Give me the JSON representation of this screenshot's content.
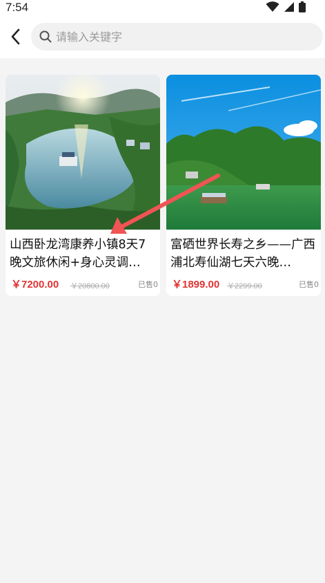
{
  "status_bar": {
    "time": "7:54",
    "icons": [
      "wifi-icon",
      "signal-icon",
      "battery-icon"
    ]
  },
  "header": {
    "back_icon": "chevron-left-icon",
    "search": {
      "placeholder": "请输入关键字",
      "value": ""
    }
  },
  "products": [
    {
      "title": "山西卧龙湾康养小镇8天7晚文旅休闲+身心灵调…",
      "price": "￥7200.00",
      "original_price": "￥20800.00",
      "sold": "已售0"
    },
    {
      "title": "富硒世界长寿之乡——广西浦北寿仙湖七天六晚…",
      "price": "￥1899.00",
      "original_price": "￥2299.00",
      "sold": "已售0"
    }
  ],
  "colors": {
    "price": "#e03434",
    "annotation_arrow": "#f05454",
    "background": "#f4f4f4"
  }
}
